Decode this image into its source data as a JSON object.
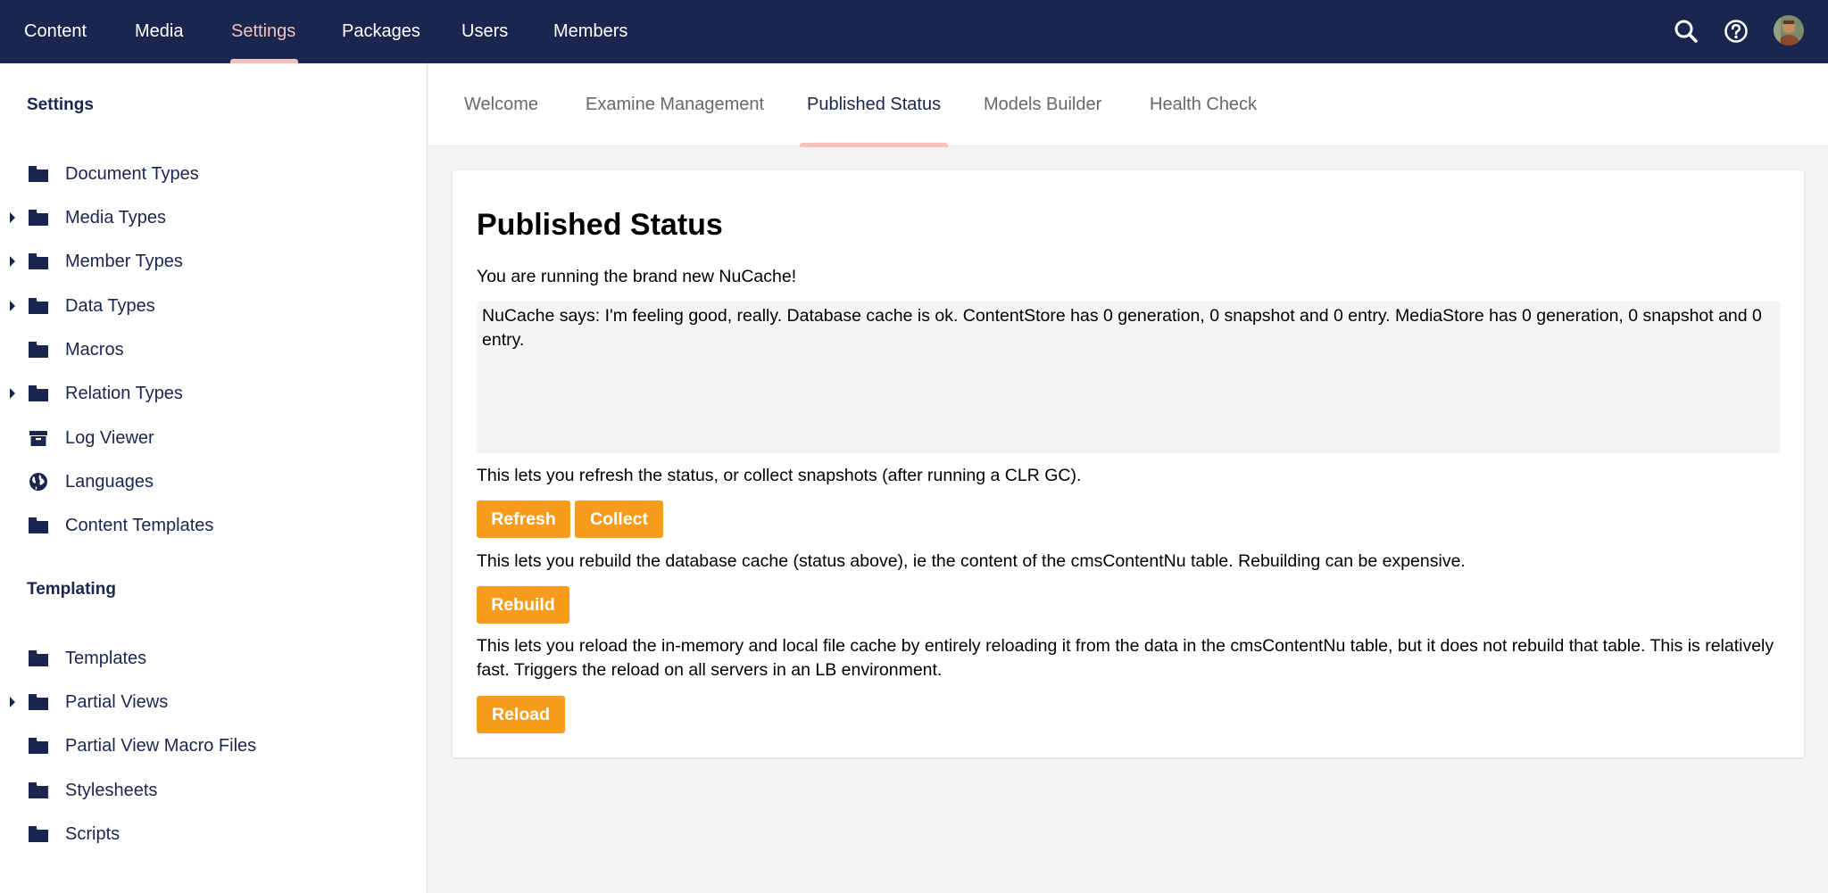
{
  "topnav": {
    "items": [
      {
        "label": "Content"
      },
      {
        "label": "Media"
      },
      {
        "label": "Settings",
        "active": true
      },
      {
        "label": "Packages"
      },
      {
        "label": "Users"
      },
      {
        "label": "Members"
      }
    ],
    "icons": [
      "search-icon",
      "help-icon",
      "user-avatar"
    ]
  },
  "sidebar": {
    "settings_title": "Settings",
    "settings_items": [
      {
        "label": "Document Types",
        "icon": "folder-icon",
        "expandable": false
      },
      {
        "label": "Media Types",
        "icon": "folder-icon",
        "expandable": true
      },
      {
        "label": "Member Types",
        "icon": "folder-icon",
        "expandable": true
      },
      {
        "label": "Data Types",
        "icon": "folder-icon",
        "expandable": true
      },
      {
        "label": "Macros",
        "icon": "folder-icon",
        "expandable": false
      },
      {
        "label": "Relation Types",
        "icon": "folder-icon",
        "expandable": true
      },
      {
        "label": "Log Viewer",
        "icon": "archive-box-icon",
        "expandable": false
      },
      {
        "label": "Languages",
        "icon": "globe-icon",
        "expandable": false
      },
      {
        "label": "Content Templates",
        "icon": "folder-icon",
        "expandable": false
      }
    ],
    "templating_title": "Templating",
    "templating_items": [
      {
        "label": "Templates",
        "icon": "folder-icon",
        "expandable": false
      },
      {
        "label": "Partial Views",
        "icon": "folder-icon",
        "expandable": true
      },
      {
        "label": "Partial View Macro Files",
        "icon": "folder-icon",
        "expandable": false
      },
      {
        "label": "Stylesheets",
        "icon": "folder-icon",
        "expandable": false
      },
      {
        "label": "Scripts",
        "icon": "folder-icon",
        "expandable": false
      }
    ]
  },
  "tabs": [
    {
      "label": "Welcome"
    },
    {
      "label": "Examine Management"
    },
    {
      "label": "Published Status",
      "active": true
    },
    {
      "label": "Models Builder"
    },
    {
      "label": "Health Check"
    }
  ],
  "panel": {
    "title": "Published Status",
    "intro": "You are running the brand new NuCache!",
    "status_text": "NuCache says: I'm feeling good, really. Database cache is ok. ContentStore has 0 generation, 0 snapshot and 0 entry. MediaStore has 0 generation, 0 snapshot and 0 entry.",
    "refresh_desc": "This lets you refresh the status, or collect snapshots (after running a CLR GC).",
    "refresh_label": "Refresh",
    "collect_label": "Collect",
    "rebuild_desc": "This lets you rebuild the database cache (status above), ie the content of the cmsContentNu table. Rebuilding can be expensive.",
    "rebuild_label": "Rebuild",
    "reload_desc": "This lets you reload the in-memory and local file cache by entirely reloading it from the data in the cmsContentNu table, but it does not rebuild that table. This is relatively fast. Triggers the reload on all servers in an LB environment.",
    "reload_label": "Reload"
  },
  "colors": {
    "nav_bg": "#1b264f",
    "nav_active": "#f5c1bc",
    "button": "#f79c1c",
    "status_bg": "#f5f5f5"
  }
}
